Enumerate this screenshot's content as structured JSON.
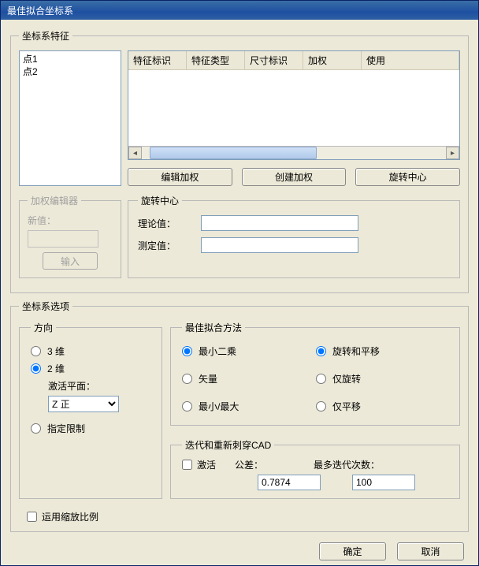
{
  "window": {
    "title": "最佳拟合坐标系"
  },
  "features": {
    "legend": "坐标系特征",
    "list": [
      "点1",
      "点2"
    ],
    "columns": [
      "特征标识",
      "特征类型",
      "尺寸标识",
      "加权",
      "使用"
    ],
    "buttons": {
      "edit_weight": "编辑加权",
      "create_weight": "创建加权",
      "rotation_center": "旋转中心"
    },
    "weight_editor": {
      "legend": "加权编辑器",
      "new_value_label": "新值：",
      "input_btn": "输入"
    },
    "rotation": {
      "legend": "旋转中心",
      "theoretical_label": "理论值：",
      "measured_label": "测定值："
    }
  },
  "options": {
    "legend": "坐标系选项",
    "direction": {
      "legend": "方向",
      "r3d": "3 维",
      "r2d": "2 维",
      "active_plane_label": "激活平面：",
      "active_plane_value": "Z 正",
      "specify_limit": "指定限制"
    },
    "method": {
      "legend": "最佳拟合方法",
      "least_squares": "最小二乘",
      "rot_trans": "旋转和平移",
      "vector": "矢量",
      "only_rotate": "仅旋转",
      "min_max": "最小/最大",
      "only_translate": "仅平移"
    },
    "iteration": {
      "legend": "迭代和重新刺穿CAD",
      "activate": "激活",
      "tolerance_label": "公差：",
      "tolerance_value": "0.7874",
      "max_iter_label": "最多迭代次数：",
      "max_iter_value": "100"
    },
    "use_scale": "运用缩放比例"
  },
  "dialog": {
    "ok": "确定",
    "cancel": "取消"
  }
}
